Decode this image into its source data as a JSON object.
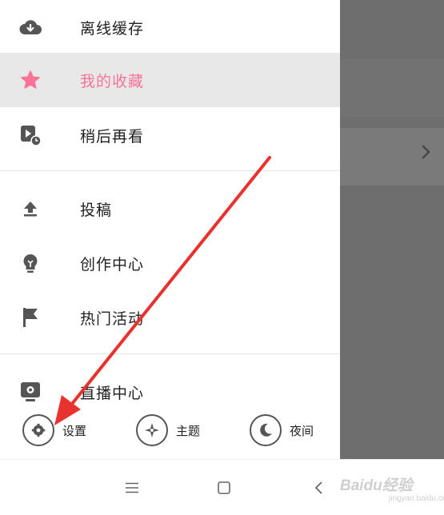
{
  "menu": {
    "items": [
      {
        "label": "离线缓存",
        "icon": "cloud-download-icon"
      },
      {
        "label": "我的收藏",
        "icon": "star-icon",
        "active": true
      },
      {
        "label": "稍后再看",
        "icon": "watch-later-icon"
      },
      {
        "label": "投稿",
        "icon": "upload-icon"
      },
      {
        "label": "创作中心",
        "icon": "lightbulb-icon"
      },
      {
        "label": "热门活动",
        "icon": "flag-icon"
      },
      {
        "label": "直播中心",
        "icon": "live-camera-icon"
      }
    ]
  },
  "bottom_bar": {
    "settings_label": "设置",
    "theme_label": "主题",
    "night_label": "夜间"
  },
  "nav_bar": {
    "buttons": [
      "menu-icon",
      "home-icon",
      "back-icon"
    ]
  },
  "watermark": {
    "text": "Baidu经验",
    "sub": "jingyan.baidu.com"
  },
  "colors": {
    "accent": "#fb7299",
    "icon": "#555555",
    "annotation_arrow": "#e8322e"
  }
}
